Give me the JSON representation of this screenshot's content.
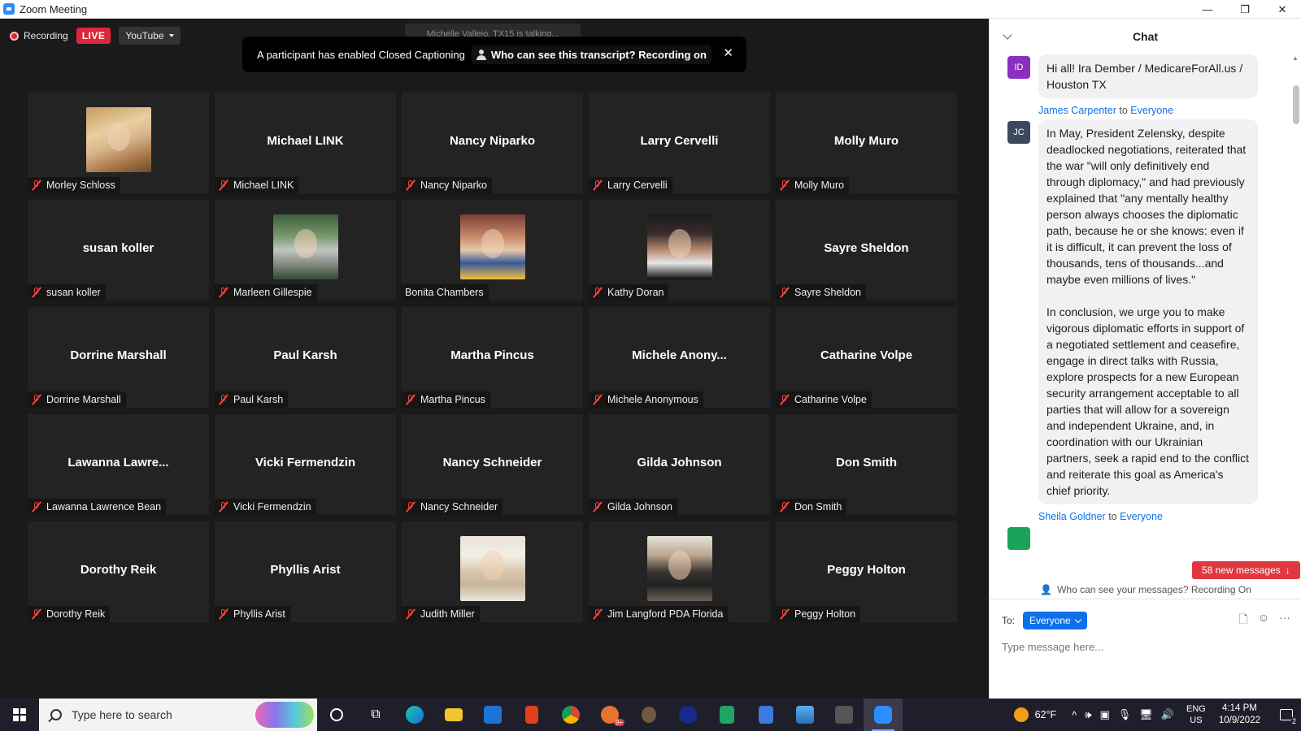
{
  "window": {
    "title": "Zoom Meeting",
    "minimize": "—",
    "restore": "❐",
    "close": "✕"
  },
  "meeting": {
    "recording_label": "Recording",
    "live_label": "LIVE",
    "stream_label": "YouTube",
    "talking": "Michelle Vallejo, TX15 is talking...",
    "cc_text": "A participant has enabled Closed Captioning",
    "cc_link": "Who can see this transcript? Recording on",
    "cc_close": "✕"
  },
  "participants": [
    {
      "display": "",
      "tag": "Morley Schloss",
      "photo": "p1",
      "muted": true
    },
    {
      "display": "Michael LINK",
      "tag": "Michael LINK",
      "photo": "",
      "muted": true
    },
    {
      "display": "Nancy Niparko",
      "tag": "Nancy Niparko",
      "photo": "",
      "muted": true
    },
    {
      "display": "Larry Cervelli",
      "tag": "Larry Cervelli",
      "photo": "",
      "muted": true
    },
    {
      "display": "Molly Muro",
      "tag": "Molly Muro",
      "photo": "",
      "muted": true
    },
    {
      "display": "susan koller",
      "tag": "susan koller",
      "photo": "",
      "muted": true
    },
    {
      "display": "",
      "tag": "Marleen Gillespie",
      "photo": "p2",
      "muted": true
    },
    {
      "display": "",
      "tag": "Bonita Chambers",
      "photo": "p3",
      "muted": false
    },
    {
      "display": "",
      "tag": "Kathy Doran",
      "photo": "p4",
      "muted": true
    },
    {
      "display": "Sayre Sheldon",
      "tag": "Sayre Sheldon",
      "photo": "",
      "muted": true
    },
    {
      "display": "Dorrine Marshall",
      "tag": "Dorrine Marshall",
      "photo": "",
      "muted": true
    },
    {
      "display": "Paul Karsh",
      "tag": "Paul Karsh",
      "photo": "",
      "muted": true
    },
    {
      "display": "Martha Pincus",
      "tag": "Martha Pincus",
      "photo": "",
      "muted": true
    },
    {
      "display": "Michele  Anony...",
      "tag": "Michele Anonymous",
      "photo": "",
      "muted": true
    },
    {
      "display": "Catharine Volpe",
      "tag": "Catharine Volpe",
      "photo": "",
      "muted": true
    },
    {
      "display": "Lawanna  Lawre...",
      "tag": "Lawanna Lawrence Bean",
      "photo": "",
      "muted": true
    },
    {
      "display": "Vicki Fermendzin",
      "tag": "Vicki Fermendzin",
      "photo": "",
      "muted": true
    },
    {
      "display": "Nancy Schneider",
      "tag": "Nancy Schneider",
      "photo": "",
      "muted": true
    },
    {
      "display": "Gilda Johnson",
      "tag": "Gilda Johnson",
      "photo": "",
      "muted": true
    },
    {
      "display": "Don Smith",
      "tag": "Don Smith",
      "photo": "",
      "muted": true
    },
    {
      "display": "Dorothy Reik",
      "tag": "Dorothy Reik",
      "photo": "",
      "muted": true
    },
    {
      "display": "Phyllis Arist",
      "tag": "Phyllis Arist",
      "photo": "",
      "muted": true
    },
    {
      "display": "",
      "tag": "Judith Miller",
      "photo": "p5",
      "muted": true
    },
    {
      "display": "",
      "tag": "Jim Langford PDA Florida",
      "photo": "p6",
      "muted": true
    },
    {
      "display": "Peggy Holton",
      "tag": "Peggy Holton",
      "photo": "",
      "muted": true
    }
  ],
  "chat": {
    "title": "Chat",
    "messages": [
      {
        "avatar": "ID",
        "sender": "",
        "to_word": "",
        "recipient": "",
        "text": "Hi all! Ira Dember / MedicareForAll.us / Houston TX"
      },
      {
        "avatar": "JC",
        "sender": "James Carpenter",
        "to_word": "to",
        "recipient": "Everyone",
        "text": "In May, President Zelensky, despite deadlocked negotiations, reiterated that the war \"will only definitively end through diplomacy,\" and had previously explained that \"any mentally healthy person always chooses the diplomatic path, because he or she knows: even if it is difficult, it can prevent the loss of thousands, tens of thousands...and maybe even millions of lives.\"\n\nIn conclusion, we urge you to make vigorous diplomatic efforts in support of a negotiated settlement and ceasefire, engage in direct talks with Russia, explore prospects for a new European security arrangement acceptable to all parties that will allow for a sovereign and independent Ukraine, and, in coordination with our Ukrainian partners, seek a rapid end to the conflict and reiterate this goal as America's chief priority."
      },
      {
        "avatar": "",
        "sender": "Sheila Goldner",
        "to_word": "to",
        "recipient": "Everyone",
        "text": ""
      }
    ],
    "new_messages": "58 new messages",
    "who_can_see": "Who can see your messages? Recording On",
    "to_label": "To:",
    "to_value": "Everyone",
    "input_placeholder": "Type message here..."
  },
  "taskbar": {
    "search_placeholder": "Type here to search",
    "notification_badge": "9+",
    "weather": "62°F",
    "lang_line1": "ENG",
    "lang_line2": "US",
    "time": "4:14 PM",
    "date": "10/9/2022",
    "notif_count": "2"
  }
}
